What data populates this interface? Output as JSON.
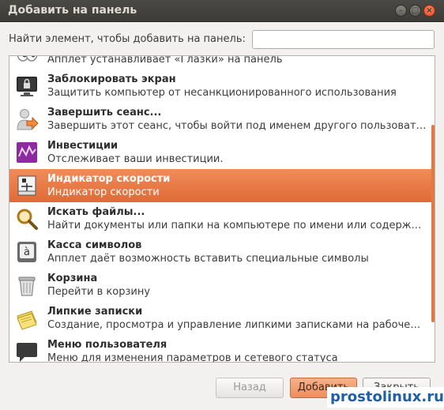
{
  "window": {
    "title": "Добавить на панель",
    "controls": {
      "minimize": "–",
      "maximize": "□",
      "close": "×"
    }
  },
  "search": {
    "label": "Найти элемент, чтобы добавить на панель:",
    "value": "",
    "placeholder": ""
  },
  "items": [
    {
      "name": "",
      "desc": "Апплет устанавливает «Глазки» на панель",
      "icon": "eyes-icon"
    },
    {
      "name": "Заблокировать экран",
      "desc": "Защитить компьютер от несанкционированного использования",
      "icon": "lock-screen-icon"
    },
    {
      "name": "Завершить сеанс...",
      "desc": "Завершить этот сеанс, чтобы войти под именем другого пользоват…",
      "icon": "logout-icon"
    },
    {
      "name": "Инвестиции",
      "desc": "Отслеживает ваши инвестиции.",
      "icon": "investments-icon"
    },
    {
      "name": "Индикатор скорости",
      "desc": "Индикатор скорости",
      "icon": "speed-indicator-icon",
      "selected": true
    },
    {
      "name": "Искать файлы...",
      "desc": "Найти документы или папки на компьютере по имени или содерж…",
      "icon": "search-files-icon"
    },
    {
      "name": "Касса символов",
      "desc": "Апплет даёт возможность вставить специальные символы",
      "icon": "character-map-icon"
    },
    {
      "name": "Корзина",
      "desc": "Перейти в корзину",
      "icon": "trash-icon"
    },
    {
      "name": "Липкие записки",
      "desc": "Создание, просмотра и управление липкими записками на рабоче…",
      "icon": "sticky-notes-icon"
    },
    {
      "name": "Меню пользователя",
      "desc": "Меню для изменения параметров и сетевого статуса",
      "icon": "user-menu-icon"
    }
  ],
  "buttons": {
    "back": "Назад",
    "add": "Добавить",
    "close": "Закрыть"
  },
  "watermark": "prostolinux.ru",
  "colors": {
    "accent": "#e06b36",
    "titlebar": "#3c3b37",
    "watermark": "#1f5fa8"
  }
}
